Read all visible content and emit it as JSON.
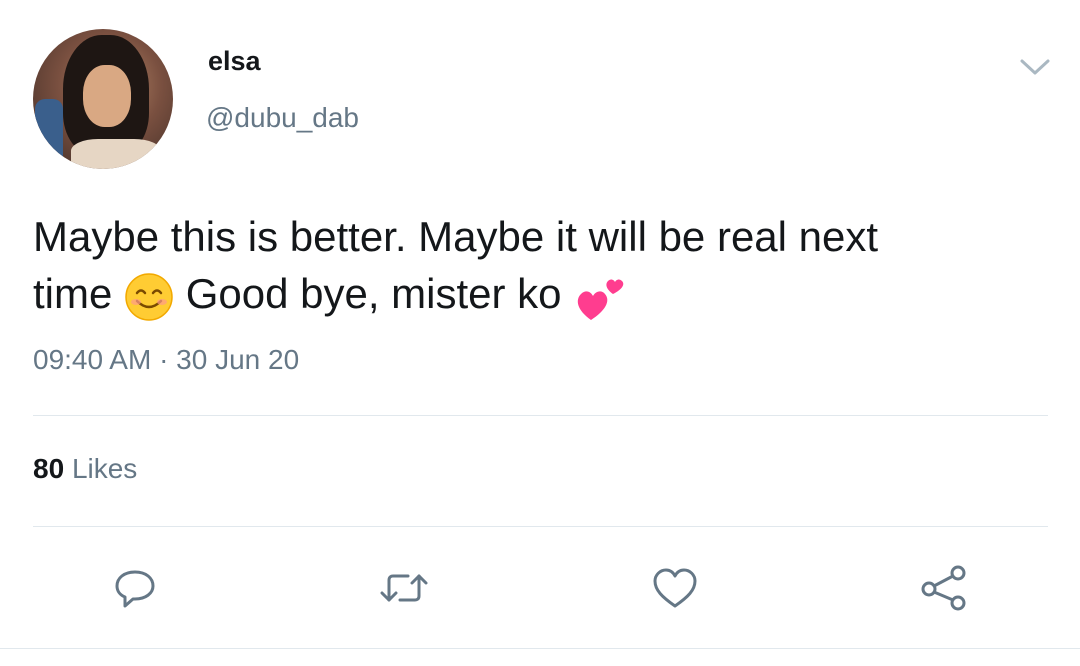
{
  "user": {
    "display_name": "elsa",
    "handle": "@dubu_dab",
    "avatar_icon": "profile-photo"
  },
  "tweet": {
    "line1": "Maybe this is better. Maybe it will be real next",
    "line2_start": "time",
    "line2_middle": "Good bye, mister ko",
    "emoji1": "smiling-face-icon",
    "emoji2": "two-hearts-icon"
  },
  "meta": {
    "timestamp": "09:40 AM · 30 Jun 20"
  },
  "stats": {
    "likes_count": "80",
    "likes_label": "Likes"
  },
  "actions": [
    {
      "name": "reply",
      "icon": "comment-icon"
    },
    {
      "name": "retweet",
      "icon": "retweet-icon"
    },
    {
      "name": "like",
      "icon": "heart-icon"
    },
    {
      "name": "share",
      "icon": "share-icon"
    }
  ],
  "colors": {
    "text": "#14171a",
    "secondary": "#657786",
    "divider": "#e1e8ed",
    "icon": "#657786"
  }
}
